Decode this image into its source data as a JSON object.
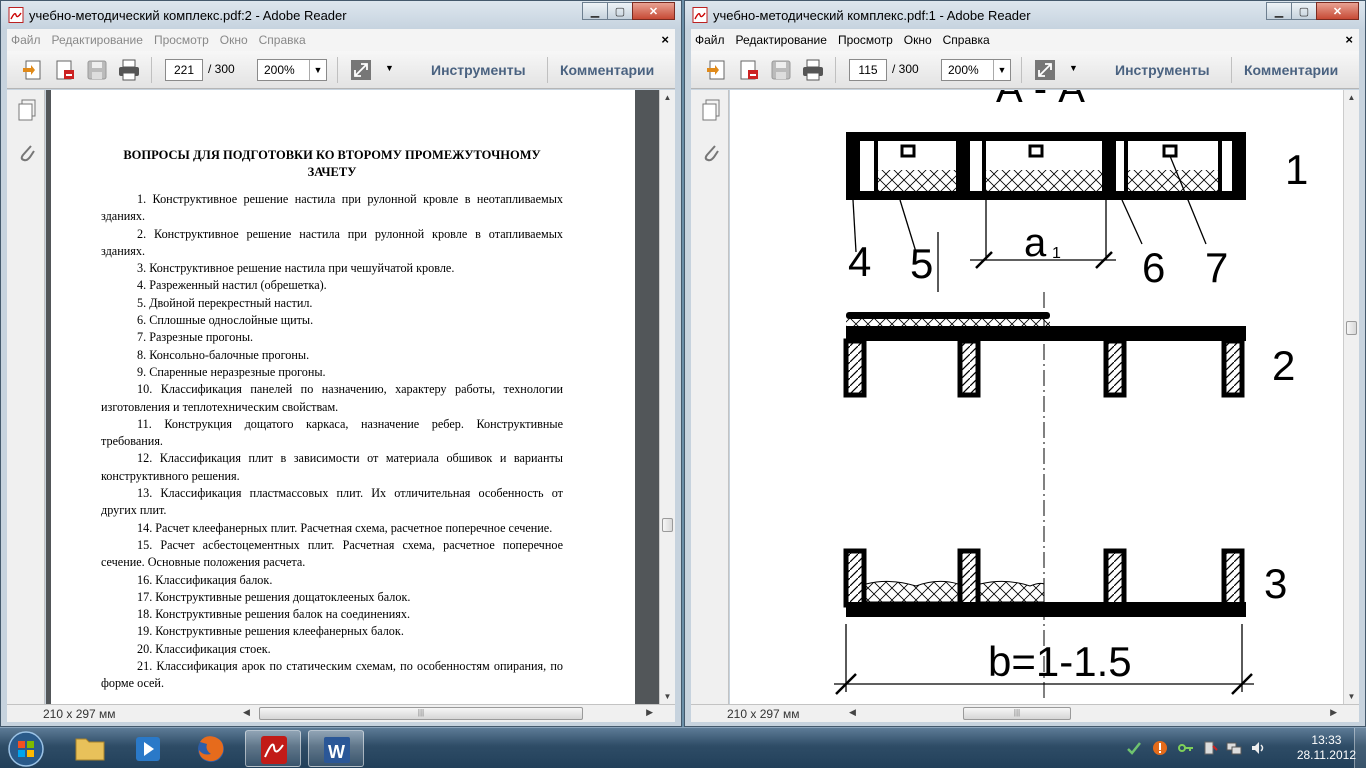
{
  "left_window": {
    "title": "учебно-методический комплекс.pdf:2 - Adobe Reader",
    "menu": [
      "Файл",
      "Редактирование",
      "Просмотр",
      "Окно",
      "Справка"
    ],
    "page_current": "221",
    "page_total": "/ 300",
    "zoom": "200%",
    "tools_label": "Инструменты",
    "comments_label": "Комментарии",
    "page_size": "210 x 297 мм",
    "doc": {
      "heading": "ВОПРОСЫ ДЛЯ ПОДГОТОВКИ КО ВТОРОМУ ПРОМЕЖУТОЧНОМУ ЗАЧЕТУ",
      "items": [
        "1. Конструктивное решение настила при рулонной кровле в неотапливаемых зданиях.",
        "2. Конструктивное решение настила при рулонной кровле в отапливаемых зданиях.",
        "3. Конструктивное решение настила при чешуйчатой кровле.",
        "4. Разреженный настил (обрешетка).",
        "5. Двойной перекрестный настил.",
        "6. Сплошные однослойные щиты.",
        "7. Разрезные прогоны.",
        "8. Консольно-балочные прогоны.",
        "9. Спаренные неразрезные прогоны.",
        "10. Классификация панелей по назначению, характеру работы, технологии изготовления и теплотехническим свойствам.",
        "11. Конструкция дощатого каркаса, назначение ребер. Конструктивные требования.",
        "12. Классификация плит в зависимости от материала обшивок и варианты конструктивного решения.",
        "13. Классификация пластмассовых плит. Их отличительная особенность от других плит.",
        "14. Расчет клеефанерных плит. Расчетная схема, расчетное поперечное сечение.",
        "15. Расчет асбестоцементных плит. Расчетная схема, расчетное поперечное сечение. Основные положения расчета.",
        "16. Классификация балок.",
        "17. Конструктивные решения дощатоклееных балок.",
        "18. Конструктивные решения балок на соединениях.",
        "19. Конструктивные решения клеефанерных балок.",
        "20. Классификация стоек.",
        "21. Классификация арок по статическим схемам, по особенностям опирания, по форме осей."
      ]
    }
  },
  "right_window": {
    "title": "учебно-методический комплекс.pdf:1 - Adobe Reader",
    "menu": [
      "Файл",
      "Редактирование",
      "Просмотр",
      "Окно",
      "Справка"
    ],
    "page_current": "115",
    "page_total": "/ 300",
    "zoom": "200%",
    "tools_label": "Инструменты",
    "comments_label": "Комментарии",
    "page_size": "210 x 297 мм",
    "drawing": {
      "section_label": "А - А",
      "callouts": [
        "1",
        "2",
        "3",
        "4",
        "5",
        "6",
        "7"
      ],
      "dim_a": "a",
      "dim_a_sub": "1",
      "dim_b": "b=1-1.5"
    }
  },
  "taskbar": {
    "time": "13:33",
    "date": "28.11.2012",
    "apps": [
      "windows-explorer",
      "media-player",
      "firefox",
      "adobe-reader",
      "microsoft-word"
    ]
  }
}
